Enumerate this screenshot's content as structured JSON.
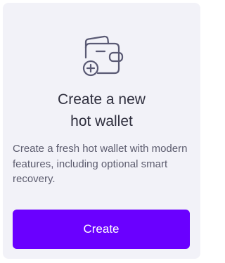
{
  "card": {
    "icon": "wallet-add-icon",
    "title_line1": "Create a new",
    "title_line2": "hot wallet",
    "description": "Create a fresh hot wallet with modern features, including optional smart recovery.",
    "button_label": "Create"
  },
  "colors": {
    "card_background": "#f2f2f8",
    "accent": "#6a00ff",
    "title_text": "#2f2f3e",
    "body_text": "#5c5c6e",
    "icon_stroke": "#5a5a74"
  }
}
